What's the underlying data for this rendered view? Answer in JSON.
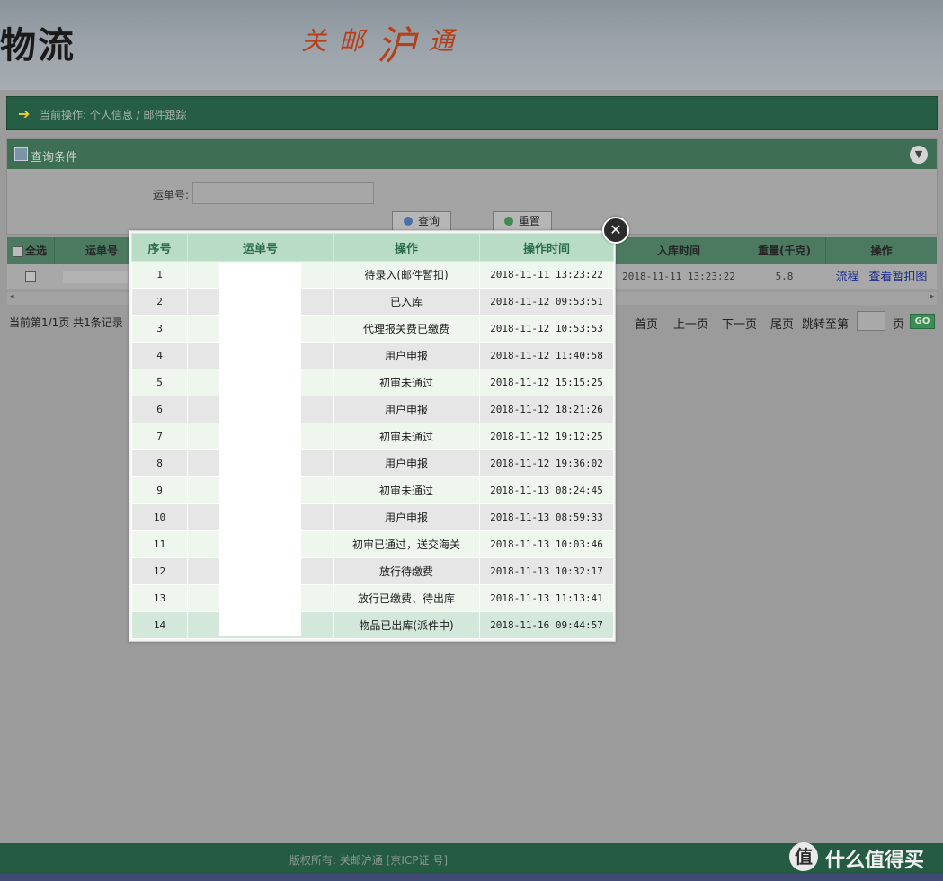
{
  "header": {
    "logo_text": "物流",
    "slogan": [
      "关",
      "邮",
      "沪",
      "通"
    ]
  },
  "breadcrumb": {
    "arrow_icon": "green-arrow-icon",
    "text": "当前操作: 个人信息 / 邮件跟踪"
  },
  "query": {
    "title": "查询条件",
    "waybill_label": "运单号:",
    "waybill_value": "",
    "search_button": "查询",
    "reset_button": "重置"
  },
  "results_table": {
    "headers": {
      "select_all": "全选",
      "waybill": "运单号",
      "inbound_time": "入库时间",
      "weight": "重量(千克)",
      "action": "操作"
    },
    "row": {
      "inbound_time": "2018-11-11 13:23:22",
      "weight": "5.8",
      "link_flow": "流程",
      "link_image": "查看暂扣图"
    }
  },
  "pager": {
    "status": "当前第1/1页 共1条记录",
    "first": "首页",
    "prev": "上一页",
    "next": "下一页",
    "last": "尾页",
    "jump_label": "跳转至第",
    "page_unit": "页",
    "go": "GO"
  },
  "modal": {
    "headers": {
      "seq": "序号",
      "waybill": "运单号",
      "operation": "操作",
      "op_time": "操作时间"
    },
    "rows": [
      {
        "seq": "1",
        "operation": "待录入(邮件暂扣)",
        "time": "2018-11-11 13:23:22"
      },
      {
        "seq": "2",
        "operation": "已入库",
        "time": "2018-11-12 09:53:51"
      },
      {
        "seq": "3",
        "operation": "代理报关费已缴费",
        "time": "2018-11-12 10:53:53"
      },
      {
        "seq": "4",
        "operation": "用户申报",
        "time": "2018-11-12 11:40:58"
      },
      {
        "seq": "5",
        "operation": "初审未通过",
        "time": "2018-11-12 15:15:25"
      },
      {
        "seq": "6",
        "operation": "用户申报",
        "time": "2018-11-12 18:21:26"
      },
      {
        "seq": "7",
        "operation": "初审未通过",
        "time": "2018-11-12 19:12:25"
      },
      {
        "seq": "8",
        "operation": "用户申报",
        "time": "2018-11-12 19:36:02"
      },
      {
        "seq": "9",
        "operation": "初审未通过",
        "time": "2018-11-13 08:24:45"
      },
      {
        "seq": "10",
        "operation": "用户申报",
        "time": "2018-11-13 08:59:33"
      },
      {
        "seq": "11",
        "operation": "初审已通过，送交海关",
        "time": "2018-11-13 10:03:46"
      },
      {
        "seq": "12",
        "operation": "放行待缴费",
        "time": "2018-11-13 10:32:17"
      },
      {
        "seq": "13",
        "operation": "放行已缴费、待出库",
        "time": "2018-11-13 11:13:41"
      },
      {
        "seq": "14",
        "operation": "物品已出库(派件中)",
        "time": "2018-11-16 09:44:57"
      }
    ]
  },
  "footer": {
    "copyright": "版权所有: 关邮沪通 [京ICP证 号]"
  },
  "watermark": {
    "badge": "值",
    "text": "什么值得买"
  }
}
